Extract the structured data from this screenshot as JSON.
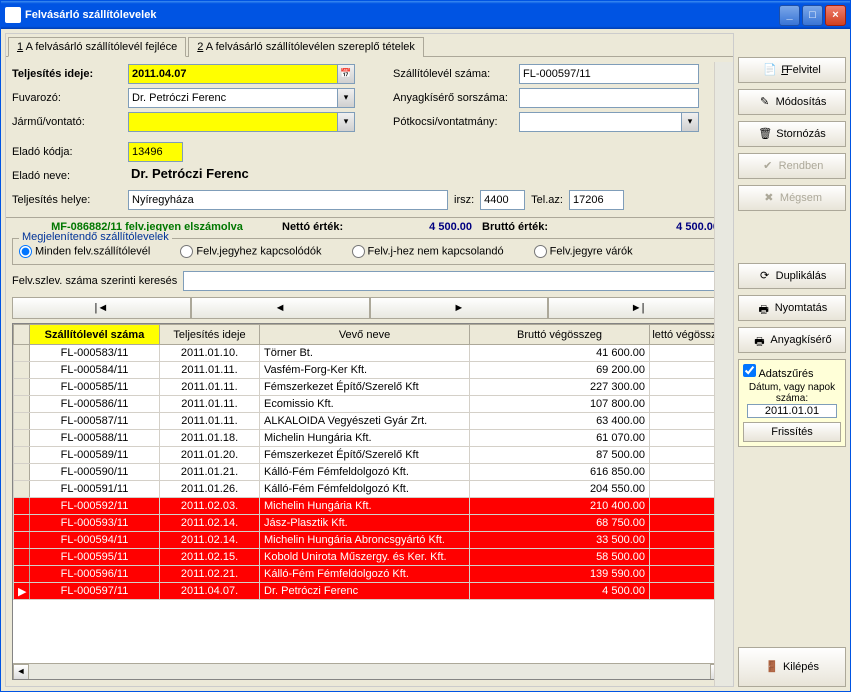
{
  "window": {
    "title": "Felvásárló szállítólevelek"
  },
  "tabs": [
    {
      "n": "1",
      "label": "A felvásárló szállítólevél fejléce"
    },
    {
      "n": "2",
      "label": "A felvásárló szállítólevélen szereplő tételek"
    }
  ],
  "form": {
    "teljesites_lbl": "Teljesítés ideje:",
    "teljesites_val": "2011.04.07",
    "szallszam_lbl": "Szállítólevél száma:",
    "szallszam_val": "FL-000597/11",
    "fuvarozo_lbl": "Fuvarozó:",
    "fuvarozo_val": "Dr. Petróczi Ferenc",
    "anyagk_lbl": "Anyagkísérő sorszáma:",
    "anyagk_val": "",
    "jarmu_lbl": "Jármű/vontató:",
    "jarmu_val": "",
    "potkocsi_lbl": "Pótkocsi/vontatmány:",
    "potkocsi_val": "",
    "elado_kod_lbl": "Eladó kódja:",
    "elado_kod_val": "13496",
    "elado_nev_lbl": "Eladó neve:",
    "elado_nev_val": "Dr. Petróczi Ferenc",
    "telj_hely_lbl": "Teljesítés helye:",
    "telj_hely_val": "Nyíregyháza",
    "irsz_lbl": "irsz:",
    "irsz_val": "4400",
    "telaz_lbl": "Tel.az:",
    "telaz_val": "17206"
  },
  "status": {
    "left": "MF-086882/11 felv.jegyen elszámolva",
    "netto_lbl": "Nettó érték:",
    "netto_val": "4 500.00",
    "brutto_lbl": "Bruttó érték:",
    "brutto_val": "4 500.00"
  },
  "filter_group": {
    "title": "Megjelenítendő szállítólevelek",
    "opts": [
      "Minden felv.szállítólevél",
      "Felv.jegyhez kapcsolódók",
      "Felv.j-hez nem kapcsolandó",
      "Felv.jegyre várók"
    ]
  },
  "search": {
    "label": "Felv.szlev. száma szerinti keresés",
    "value": ""
  },
  "grid": {
    "headers": [
      "Szállítólevél száma",
      "Teljesítés ideje",
      "Vevő neve",
      "Bruttó végösszeg",
      "lettó végössze"
    ],
    "rows": [
      {
        "c": [
          "FL-000583/11",
          "2011.01.10.",
          "Törner Bt.",
          "41 600.00",
          ""
        ],
        "red": false
      },
      {
        "c": [
          "FL-000584/11",
          "2011.01.11.",
          "Vasfém-Forg-Ker Kft.",
          "69 200.00",
          ""
        ],
        "red": false
      },
      {
        "c": [
          "FL-000585/11",
          "2011.01.11.",
          "Fémszerkezet Építő/Szerelő Kft",
          "227 300.00",
          ""
        ],
        "red": false
      },
      {
        "c": [
          "FL-000586/11",
          "2011.01.11.",
          "Ecomissio Kft.",
          "107 800.00",
          ""
        ],
        "red": false
      },
      {
        "c": [
          "FL-000587/11",
          "2011.01.11.",
          "ALKALOIDA Vegyészeti Gyár Zrt.",
          "63 400.00",
          ""
        ],
        "red": false
      },
      {
        "c": [
          "FL-000588/11",
          "2011.01.18.",
          "Michelin Hungária Kft.",
          "61 070.00",
          ""
        ],
        "red": false
      },
      {
        "c": [
          "FL-000589/11",
          "2011.01.20.",
          "Fémszerkezet Építő/Szerelő Kft",
          "87 500.00",
          ""
        ],
        "red": false
      },
      {
        "c": [
          "FL-000590/11",
          "2011.01.21.",
          "Kálló-Fém Fémfeldolgozó Kft.",
          "616 850.00",
          ""
        ],
        "red": false
      },
      {
        "c": [
          "FL-000591/11",
          "2011.01.26.",
          "Kálló-Fém Fémfeldolgozó Kft.",
          "204 550.00",
          ""
        ],
        "red": false
      },
      {
        "c": [
          "FL-000592/11",
          "2011.02.03.",
          "Michelin Hungária Kft.",
          "210 400.00",
          ""
        ],
        "red": true
      },
      {
        "c": [
          "FL-000593/11",
          "2011.02.14.",
          "Jász-Plasztik Kft.",
          "68 750.00",
          ""
        ],
        "red": true
      },
      {
        "c": [
          "FL-000594/11",
          "2011.02.14.",
          "Michelin Hungária Abroncsgyártó Kft.",
          "33 500.00",
          ""
        ],
        "red": true
      },
      {
        "c": [
          "FL-000595/11",
          "2011.02.15.",
          "Kobold Unirota Műszergy. és Ker. Kft.",
          "58 500.00",
          ""
        ],
        "red": true
      },
      {
        "c": [
          "FL-000596/11",
          "2011.02.21.",
          "Kálló-Fém Fémfeldolgozó Kft.",
          "139 590.00",
          ""
        ],
        "red": true
      },
      {
        "c": [
          "FL-000597/11",
          "2011.04.07.",
          "Dr. Petróczi Ferenc",
          "4 500.00",
          ""
        ],
        "red": true,
        "sel": true
      }
    ]
  },
  "buttons": {
    "felvitel": "Felvitel",
    "modositas": "Módosítás",
    "stornozas": "Stornózás",
    "rendben": "Rendben",
    "megsem": "Mégsem",
    "duplikalas": "Duplikálás",
    "nyomtatas": "Nyomtatás",
    "anyagkisero": "Anyagkísérő",
    "kilepes": "Kilépés",
    "frissites": "Frissítés"
  },
  "datefilter": {
    "chk": "Adatszűrés",
    "label": "Dátum, vagy napok száma:",
    "value": "2011.01.01"
  }
}
